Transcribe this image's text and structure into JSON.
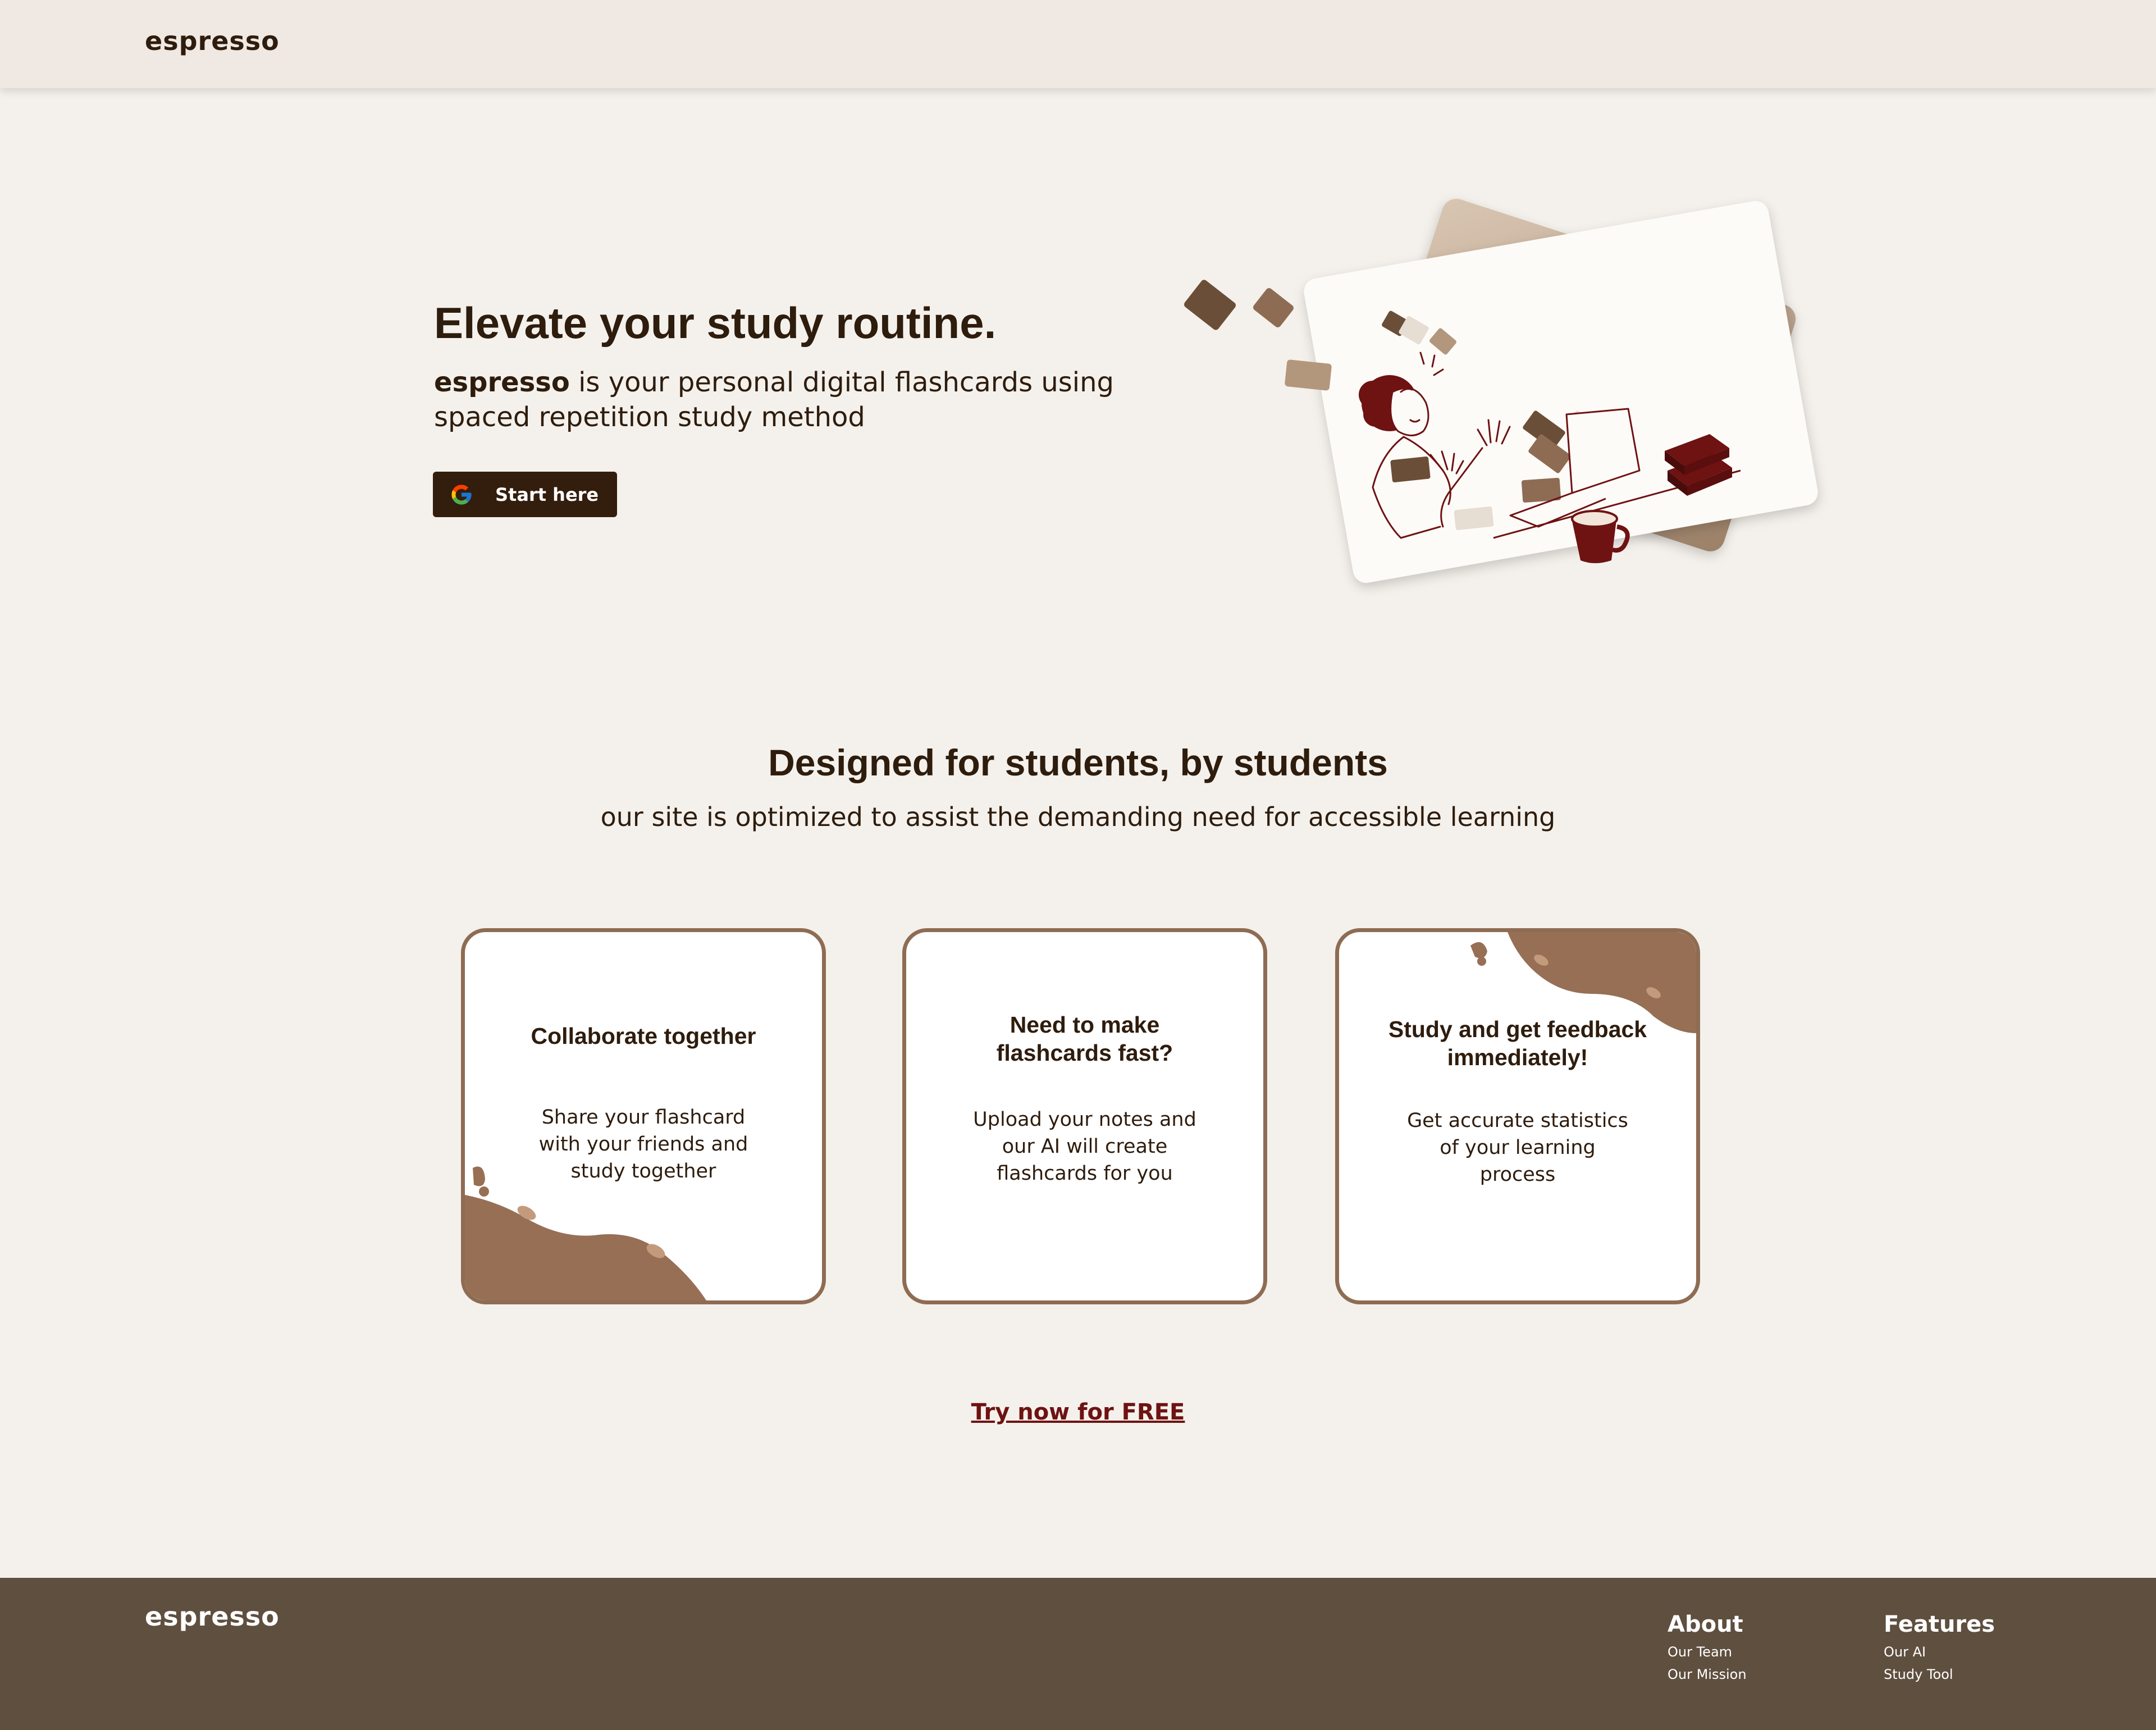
{
  "header": {
    "logo": "espresso"
  },
  "hero": {
    "title": "Elevate your study routine.",
    "subtitle_brand": "espresso",
    "subtitle_rest": " is your personal digital flashcards using spaced repetition study method",
    "start_button": "Start here"
  },
  "features": {
    "title": "Designed for students, by students",
    "subtitle": "our site is optimized to assist the demanding need for accessible learning",
    "cards": [
      {
        "title": "Collaborate together",
        "body": "Share your flashcard with your friends and study together"
      },
      {
        "title": "Need to make flashcards fast?",
        "body": "Upload your notes and our AI will create flashcards for you"
      },
      {
        "title": "Study and get feedback immediately!",
        "body": "Get accurate statistics of your learning process"
      }
    ],
    "cta": "Try now for FREE"
  },
  "footer": {
    "logo": "espresso",
    "columns": [
      {
        "heading": "About",
        "links": [
          "Our Team",
          "Our Mission"
        ]
      },
      {
        "heading": "Features",
        "links": [
          "Our AI",
          "Study Tool"
        ]
      }
    ]
  },
  "colors": {
    "background": "#f4f1ec",
    "header": "#f0e9e3",
    "text": "#2e1c0d",
    "button": "#331d0c",
    "card_border": "#8e6c53",
    "link": "#6e1212",
    "footer": "#5f4f3f"
  },
  "icons": [
    "google-icon",
    "study-illustration"
  ]
}
